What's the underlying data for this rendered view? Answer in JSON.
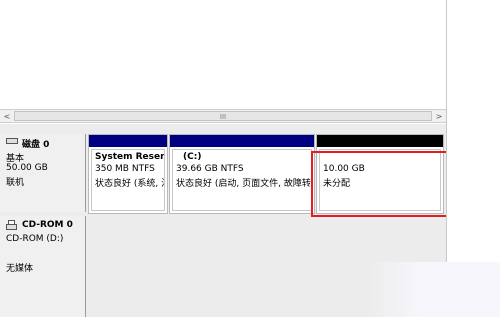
{
  "scrollbar": {
    "left_arrow": "<",
    "grip": "III",
    "right_arrow": ">"
  },
  "disks": [
    {
      "name": "磁盘 0",
      "type": "基本",
      "size": "50.00 GB",
      "status": "联机",
      "partitions": [
        {
          "name": "System Reserve",
          "size_fs": "350 MB NTFS",
          "status": "状态良好 (系统, 活",
          "bar_color": "#000080"
        },
        {
          "name": "(C:)",
          "size_fs": "39.66 GB NTFS",
          "status": "状态良好 (启动, 页面文件, 故障转储",
          "bar_color": "#000080"
        },
        {
          "name": "",
          "size_fs": "10.00 GB",
          "status": "未分配",
          "bar_color": "#000000"
        }
      ]
    },
    {
      "name": "CD-ROM 0",
      "type": "CD-ROM (D:)",
      "status": "无媒体"
    }
  ],
  "colors": {
    "primary_bar": "#000080",
    "unallocated_bar": "#000000",
    "highlight": "#e02020"
  }
}
